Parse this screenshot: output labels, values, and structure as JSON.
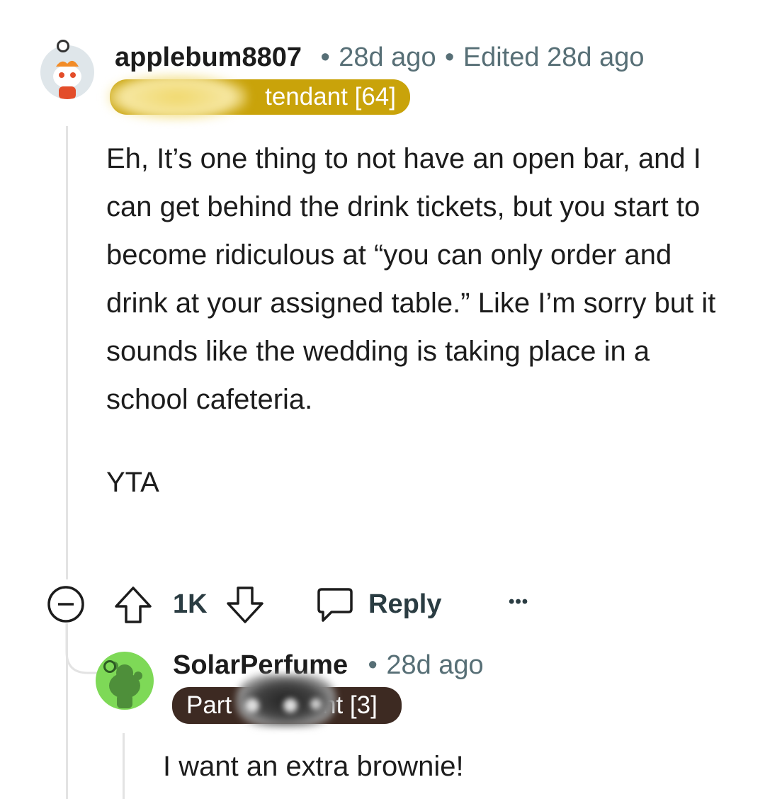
{
  "comment": {
    "username": "applebum8807",
    "time": "28d ago",
    "edited": "Edited 28d ago",
    "separator": "•",
    "flair": "tendant [64]",
    "body_paragraphs": [
      "Eh, It’s one thing to not have an open bar, and I can get behind the drink tickets, but you start to become ridiculous at “you can only order and drink at your assigned table.” Like I’m sorry but it sounds like the wedding is taking place in a school cafeteria.",
      "YTA"
    ],
    "vote_count": "1K",
    "reply_label": "Reply",
    "more_label": "•••"
  },
  "reply": {
    "username": "SolarPerfume",
    "time": "28d ago",
    "separator": "•",
    "flair_start": "Part",
    "flair_end": "nt [3]",
    "body": "I want an extra brownie!"
  },
  "colors": {
    "flair_gold": "#c9a30a",
    "flair_dark": "#3d2a22",
    "reply_avatar_bg": "#7ed957",
    "meta_gray": "#576f76"
  },
  "icons": [
    "collapse-icon",
    "upvote-icon",
    "downvote-icon",
    "comment-icon",
    "more-icon"
  ]
}
